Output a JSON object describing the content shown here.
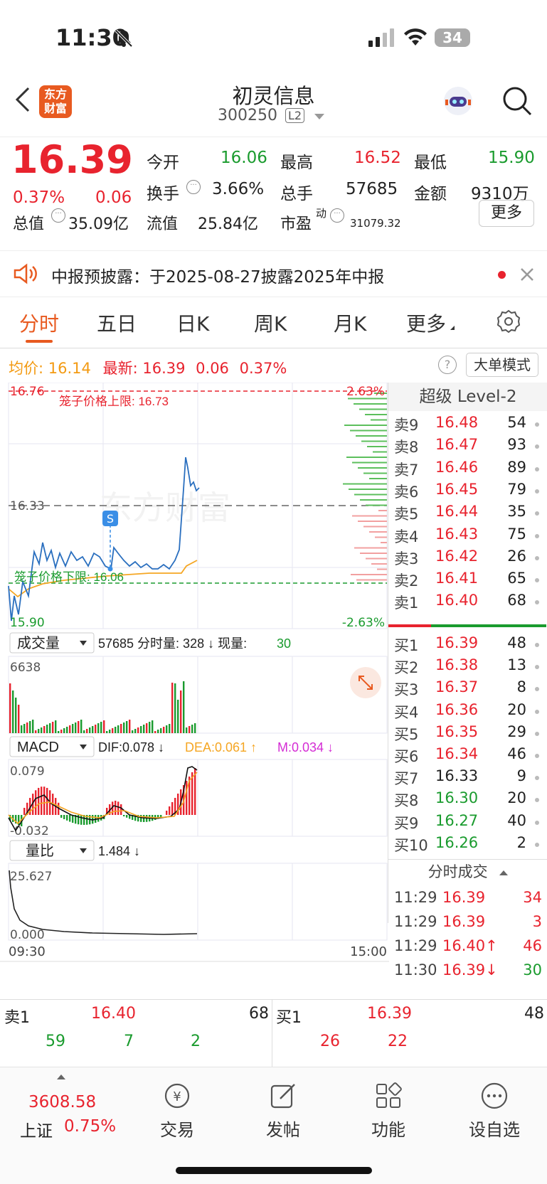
{
  "status": {
    "time": "11:30",
    "battery": "34"
  },
  "header": {
    "name": "初灵信息",
    "code": "300250",
    "level": "L2",
    "logo_line1": "东方",
    "logo_line2": "财富"
  },
  "quote": {
    "price": "16.39",
    "pct": "0.37%",
    "chg": "0.06",
    "open_label": "今开",
    "open": "16.06",
    "high_label": "最高",
    "high": "16.52",
    "low_label": "最低",
    "low": "15.90",
    "turnover_label": "换手",
    "turnover": "3.66%",
    "vol_label": "总手",
    "vol": "57685",
    "amount_label": "金额",
    "amount": "9310万",
    "mcap_label": "总值",
    "mcap": "35.09亿",
    "float_label": "流值",
    "float": "25.84亿",
    "pe_label": "市盈",
    "pe_sup": "动",
    "pe": "31079.32",
    "more": "更多"
  },
  "notice": {
    "text": "中报预披露：于2025-08-27披露2025年中报"
  },
  "tabs": [
    "分时",
    "五日",
    "日K",
    "周K",
    "月K",
    "更多"
  ],
  "info": {
    "avg_label": "均价:",
    "avg": "16.14",
    "latest_label": "最新:",
    "latest": "16.39",
    "chg": "0.06",
    "pct": "0.37%",
    "mode_btn": "大单模式"
  },
  "price_chart": {
    "top": "16.76",
    "mid": "16.33",
    "bottom": "15.90",
    "top_pct": "2.63%",
    "bottom_pct": "-2.63%",
    "upper_label": "笼子价格上限: 16.73",
    "lower_label": "笼子价格下限: 16.06",
    "watermark": "东方财富",
    "marker": "S"
  },
  "volume": {
    "selector": "成交量",
    "summary": "57685 分时量: 328 ↓ 现量:",
    "now": "30",
    "max": "6638"
  },
  "macd": {
    "selector": "MACD",
    "dif": "DIF:0.078 ↓",
    "dea": "DEA:0.061 ↑",
    "m": "M:0.034 ↓",
    "max": "0.079",
    "min": "-0.032"
  },
  "ratio": {
    "selector": "量比",
    "value": "1.484 ↓",
    "max": "25.627",
    "min": "0.000",
    "start_time": "09:30",
    "end_time": "15:00"
  },
  "orderbook": {
    "title": "超级 Level-2",
    "asks": [
      [
        "卖9",
        "16.48",
        "54"
      ],
      [
        "卖8",
        "16.47",
        "93"
      ],
      [
        "卖7",
        "16.46",
        "89"
      ],
      [
        "卖6",
        "16.45",
        "79"
      ],
      [
        "卖5",
        "16.44",
        "35"
      ],
      [
        "卖4",
        "16.43",
        "75"
      ],
      [
        "卖3",
        "16.42",
        "26"
      ],
      [
        "卖2",
        "16.41",
        "65"
      ],
      [
        "卖1",
        "16.40",
        "68"
      ]
    ],
    "bids": [
      [
        "买1",
        "16.39",
        "48"
      ],
      [
        "买2",
        "16.38",
        "13"
      ],
      [
        "买3",
        "16.37",
        "8"
      ],
      [
        "买4",
        "16.36",
        "20"
      ],
      [
        "买5",
        "16.35",
        "29"
      ],
      [
        "买6",
        "16.34",
        "46"
      ],
      [
        "买7",
        "16.33",
        "9"
      ],
      [
        "买8",
        "16.30",
        "20"
      ],
      [
        "买9",
        "16.27",
        "40"
      ],
      [
        "买10",
        "16.26",
        "2"
      ]
    ],
    "ticks_title": "分时成交",
    "ticks": [
      [
        "11:29",
        "16.39",
        "34"
      ],
      [
        "11:29",
        "16.39",
        "3"
      ],
      [
        "11:29",
        "16.40↑",
        "46"
      ],
      [
        "11:30",
        "16.39↓",
        "30"
      ]
    ]
  },
  "queue": {
    "sell_label": "卖1",
    "sell_price": "16.40",
    "sell_vol": "68",
    "sell_q": [
      "59",
      "7",
      "2"
    ],
    "buy_label": "买1",
    "buy_price": "16.39",
    "buy_vol": "48",
    "buy_q": [
      "26",
      "22"
    ]
  },
  "nav": {
    "index_value": "3608.58",
    "index_name": "上证",
    "index_pct": "0.75%",
    "trade": "交易",
    "post": "发帖",
    "func": "功能",
    "watch": "设自选"
  }
}
